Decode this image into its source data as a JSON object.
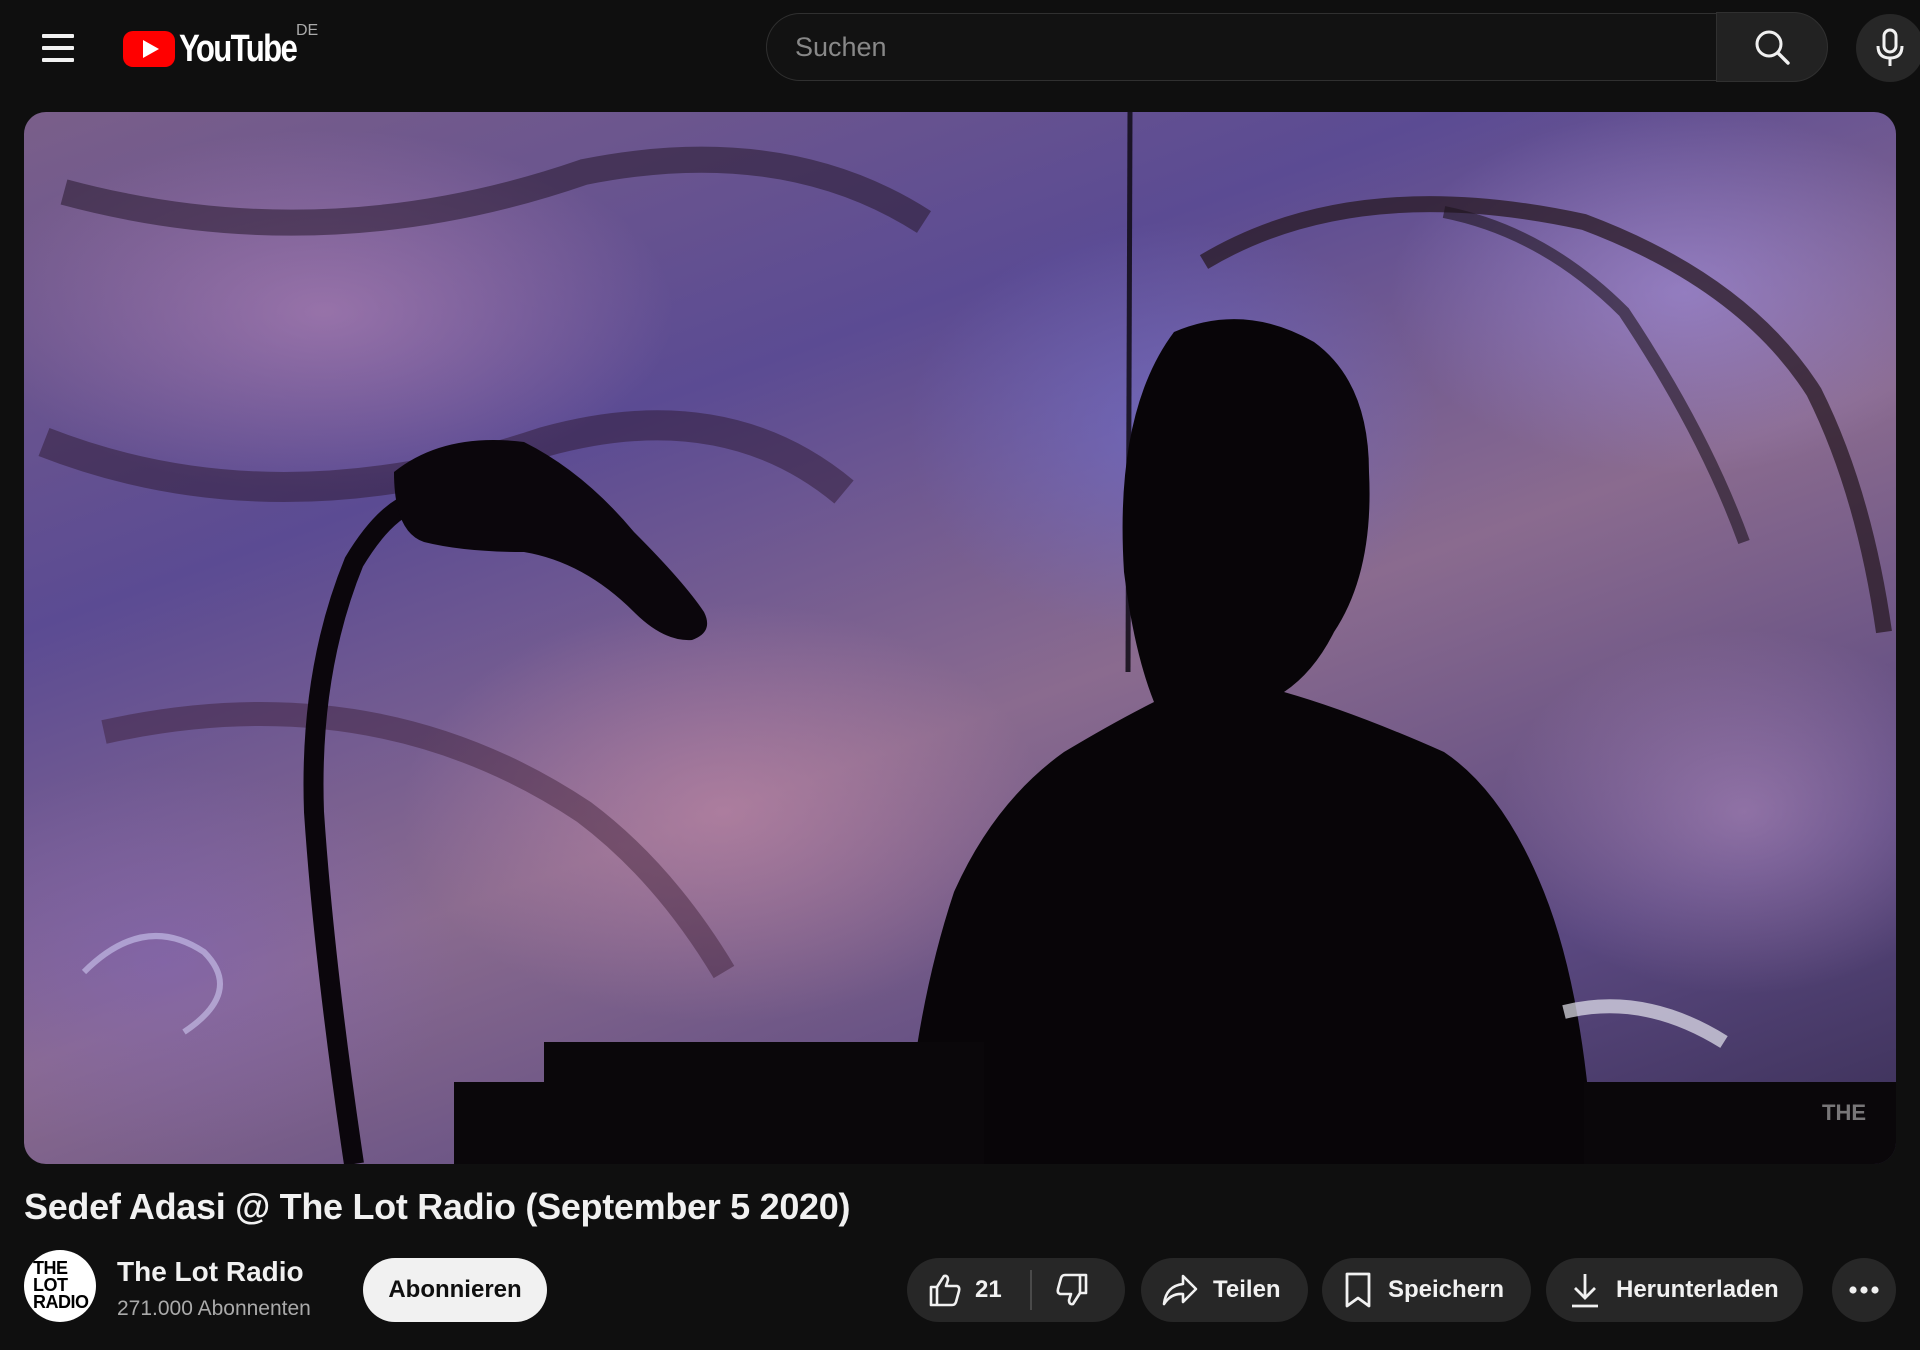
{
  "header": {
    "logo_text": "YouTube",
    "region": "DE",
    "search_placeholder": "Suchen"
  },
  "video": {
    "title": "Sedef Adasi @ The Lot Radio (September 5 2020)",
    "watermark": "THE"
  },
  "channel": {
    "name": "The Lot Radio",
    "subscribers": "271.000 Abonnenten",
    "avatar_text": "THE LOT RADIO"
  },
  "actions": {
    "subscribe_label": "Abonnieren",
    "like_count": "21",
    "share_label": "Teilen",
    "save_label": "Speichern",
    "download_label": "Herunterladen"
  },
  "icons": {
    "menu": "menu-icon",
    "search": "search-icon",
    "mic": "mic-icon",
    "like": "thumbs-up-icon",
    "dislike": "thumbs-down-icon",
    "share": "share-arrow-icon",
    "save": "bookmark-icon",
    "download": "download-icon",
    "more": "more-horizontal-icon"
  },
  "colors": {
    "background": "#0f0f0f",
    "brand_red": "#ff0000",
    "button_bg": "#272727",
    "subscribe_bg": "#f1f1f1"
  }
}
